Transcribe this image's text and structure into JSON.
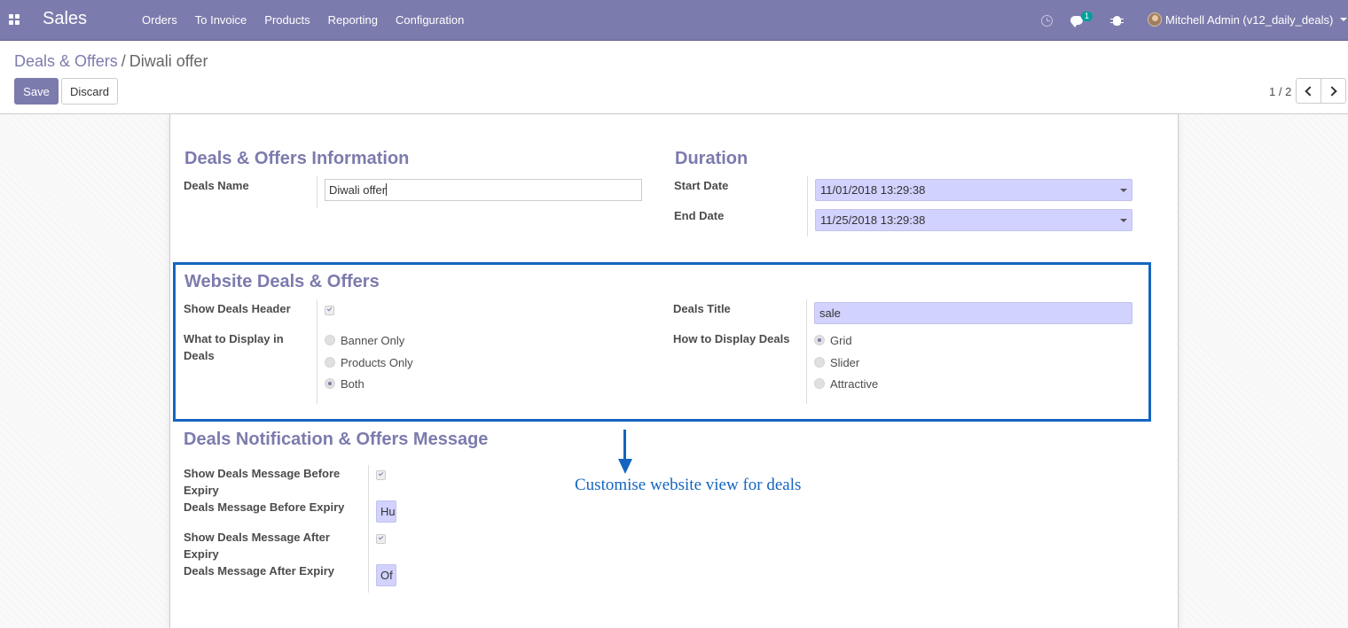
{
  "navbar": {
    "app_name": "Sales",
    "menu": [
      "Orders",
      "To Invoice",
      "Products",
      "Reporting",
      "Configuration"
    ],
    "chat_badge": "1",
    "user": "Mitchell Admin (v12_daily_deals)",
    "background_color": "#7c7bad",
    "icons": [
      "apps-icon",
      "clock-icon",
      "chat-icon",
      "bug-icon"
    ]
  },
  "breadcrumb": {
    "parent": "Deals & Offers",
    "separator": "/",
    "current": "Diwali offer"
  },
  "buttons": {
    "save": "Save",
    "discard": "Discard"
  },
  "pager": {
    "value": "1 / 2"
  },
  "sections": {
    "info": {
      "title": "Deals & Offers Information",
      "deals_name_label": "Deals Name",
      "deals_name_value": "Diwali offer"
    },
    "duration": {
      "title": "Duration",
      "start_label": "Start Date",
      "start_value": "11/01/2018 13:29:38",
      "end_label": "End Date",
      "end_value": "11/25/2018 13:29:38"
    },
    "website": {
      "title": "Website Deals & Offers",
      "show_header_label": "Show Deals Header",
      "show_header_checked": true,
      "display_label": "What to Display in Deals",
      "display_options": [
        "Banner Only",
        "Products Only",
        "Both"
      ],
      "display_selected": "Both",
      "deals_title_label": "Deals Title",
      "deals_title_value": "sale",
      "how_display_label": "How to Display Deals",
      "how_display_options": [
        "Grid",
        "Slider",
        "Attractive"
      ],
      "how_display_selected": "Grid"
    },
    "notification": {
      "title": "Deals Notification & Offers Message",
      "show_before_label": "Show Deals Message Before Expiry",
      "show_before_checked": true,
      "msg_before_label": "Deals Message Before Expiry",
      "msg_before_value": "Hu",
      "show_after_label": "Show Deals Message After Expiry",
      "show_after_checked": true,
      "msg_after_label": "Deals Message After Expiry",
      "msg_after_value": "Of"
    }
  },
  "annotation": {
    "text": "Customise website view for deals",
    "color": "#1565c0"
  }
}
